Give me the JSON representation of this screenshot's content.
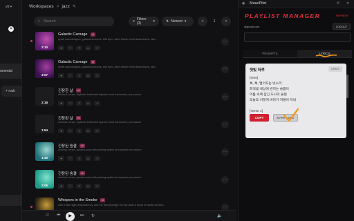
{
  "sidebar": {
    "select_value": "v6",
    "instrumental_label": "umental",
    "rock_label": "rock",
    "rock_plus": "+"
  },
  "breadcrumb": {
    "root": "Workspaces",
    "sep": ">",
    "current": "jazz"
  },
  "toolbar": {
    "search_placeholder": "Search",
    "filters_label": "Filters (3)",
    "sort_label": "Newest",
    "page_prev": "<",
    "page_num": "1",
    "page_next": ">"
  },
  "songs": [
    {
      "title": "Galactic Carnage",
      "badge": "v6",
      "duration": "2:10",
      "desc": "synth soundscapes, guttural screams, 180 bpm, alien thrash metal blast drums, alie...",
      "colors": [
        "#5a1b6e",
        "#c04fb0"
      ],
      "dot": true
    },
    {
      "title": "Galactic Carnage",
      "badge": "v6",
      "duration": "3:07",
      "desc": "synth soundscapes, guttural screams, 180 bpm, alien thrash metal blast drums, alie...",
      "colors": [
        "#3a1050",
        "#a23d9e"
      ],
      "dot": false
    },
    {
      "title": "긴장한 날",
      "badge": "v6",
      "duration": "2:18",
      "desc": "minimal, tense, rhythmic build with layered vocal harmonies, percussive",
      "colors": [
        "#1c1c1f",
        "#1c1c1f"
      ],
      "dot": false
    },
    {
      "title": "긴장된 날",
      "badge": "v6",
      "duration": "1:54",
      "desc": "minimal, tense, rhythmic build with layered vocal harmonies, percussive",
      "colors": [
        "#1c1c1f",
        "#1c1c1f"
      ],
      "dot": false
    },
    {
      "title": "긴장된 숨결",
      "badge": "v6",
      "duration": "1:40",
      "desc": "minimal, tense, spoken-word with pulsing synths and sparse percussion",
      "colors": [
        "#1b6f78",
        "#9bd6cf"
      ],
      "dot": false
    },
    {
      "title": "긴장된 숨결",
      "badge": "v6",
      "duration": "2:05",
      "desc": "minimal, tense, spoken-word with pulsing synths and sparse percussion",
      "colors": [
        "#1e9c8a",
        "#7fe0cc"
      ],
      "dot": false
    },
    {
      "title": "Whispers in the Smoke",
      "badge": "v6",
      "duration": "",
      "desc": "with a late-night despondency, and the faint smudge of vinyl adds a touch of wistful dreami...",
      "colors": [
        "#2a2410",
        "#c99a3a"
      ],
      "dot": true
    }
  ],
  "song_actions": [
    "♥",
    "♡",
    "⇪",
    "▭",
    "↗"
  ],
  "more_label": "···",
  "extension": {
    "app_name": "MusePilot",
    "title": "PLAYLIST MANAGER",
    "status": "REFRESH",
    "email": "@gmail.com",
    "logout": "LOGOUT",
    "tabs": [
      "PROMPTS",
      "LYRICS"
    ],
    "active_tab": "LYRICS",
    "lyric_title": "젯빛 하루",
    "draft": "DRAFT",
    "lyrics": "[Intro]\n톡, 톡, 떨어지는 빗소리\n회색빛 세상에 번지는 슬픔이\n어둠 속에 잠긴 도시의 불빛\n오늘도 어떻게 버텨가 저물어 지네\n\n[Verse 1]",
    "copy": "COPY",
    "mark_used": "MARK USED"
  },
  "colors": {
    "accent_red": "#d0202e",
    "badge_pink": "#7b2a4a",
    "check_orange": "#f39a1c"
  }
}
